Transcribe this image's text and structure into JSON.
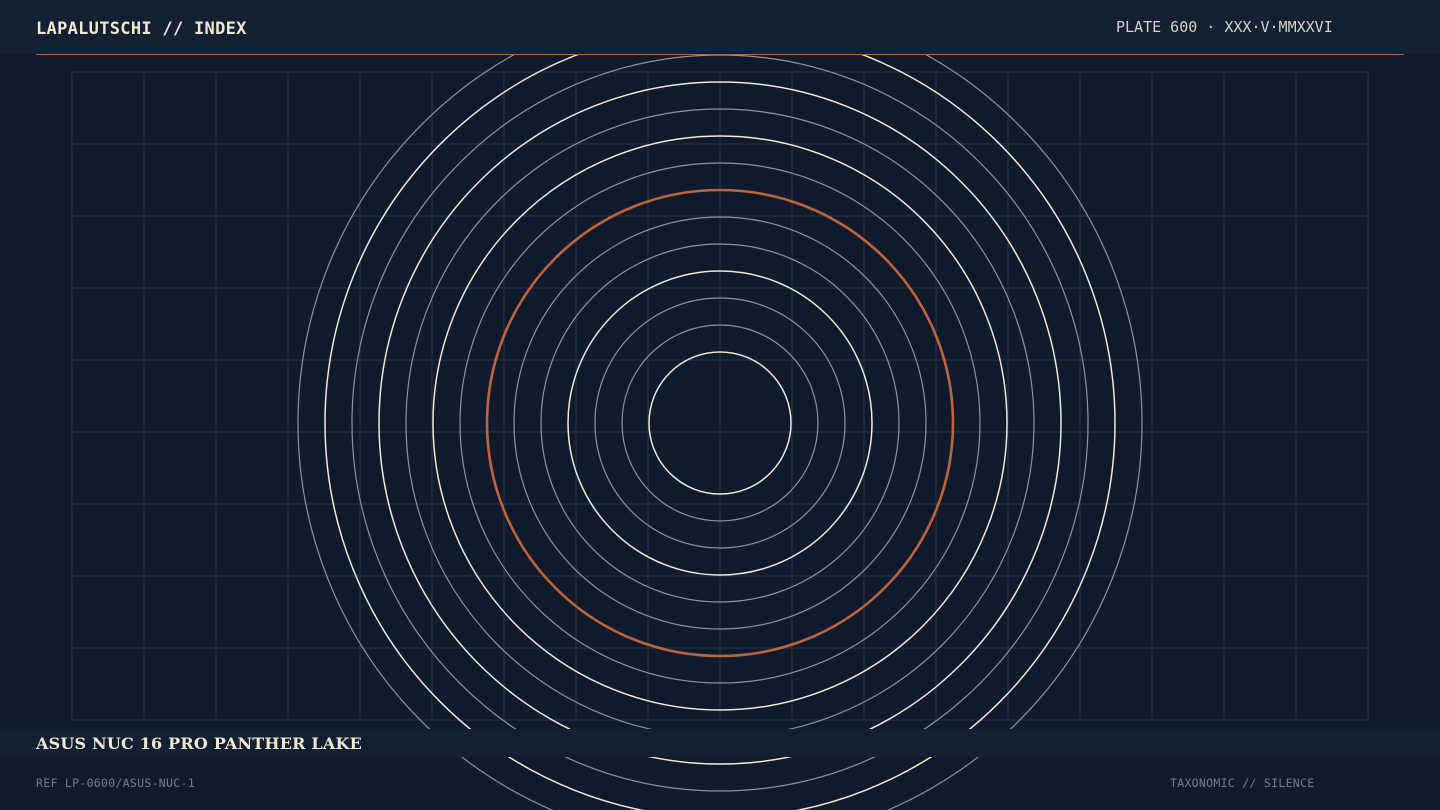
{
  "header": {
    "brand": "LAPALUTSCHI // INDEX",
    "plate": "PLATE 600 · XXX·V·MMXXVI"
  },
  "footer": {
    "title": "ASUS NUC 16 PRO PANTHER LAKE",
    "ref": "REF LP-0600/ASUS-NUC-1",
    "tagline": "TAXONOMIC // SILENCE"
  },
  "palette": {
    "background": "#0f1a2d",
    "band": "#131f33",
    "grid": "#273449",
    "ring_primary": "#f1e8d2",
    "ring_secondary": "#8893a6",
    "accent": "#c0623a"
  },
  "rings": [
    {
      "kind": "primary"
    },
    {
      "kind": "secondary"
    },
    {
      "kind": "secondary"
    },
    {
      "kind": "primary"
    },
    {
      "kind": "secondary"
    },
    {
      "kind": "secondary"
    },
    {
      "kind": "accent"
    },
    {
      "kind": "secondary"
    },
    {
      "kind": "primary"
    },
    {
      "kind": "secondary"
    },
    {
      "kind": "primary"
    },
    {
      "kind": "secondary"
    },
    {
      "kind": "primary"
    },
    {
      "kind": "secondary"
    }
  ]
}
